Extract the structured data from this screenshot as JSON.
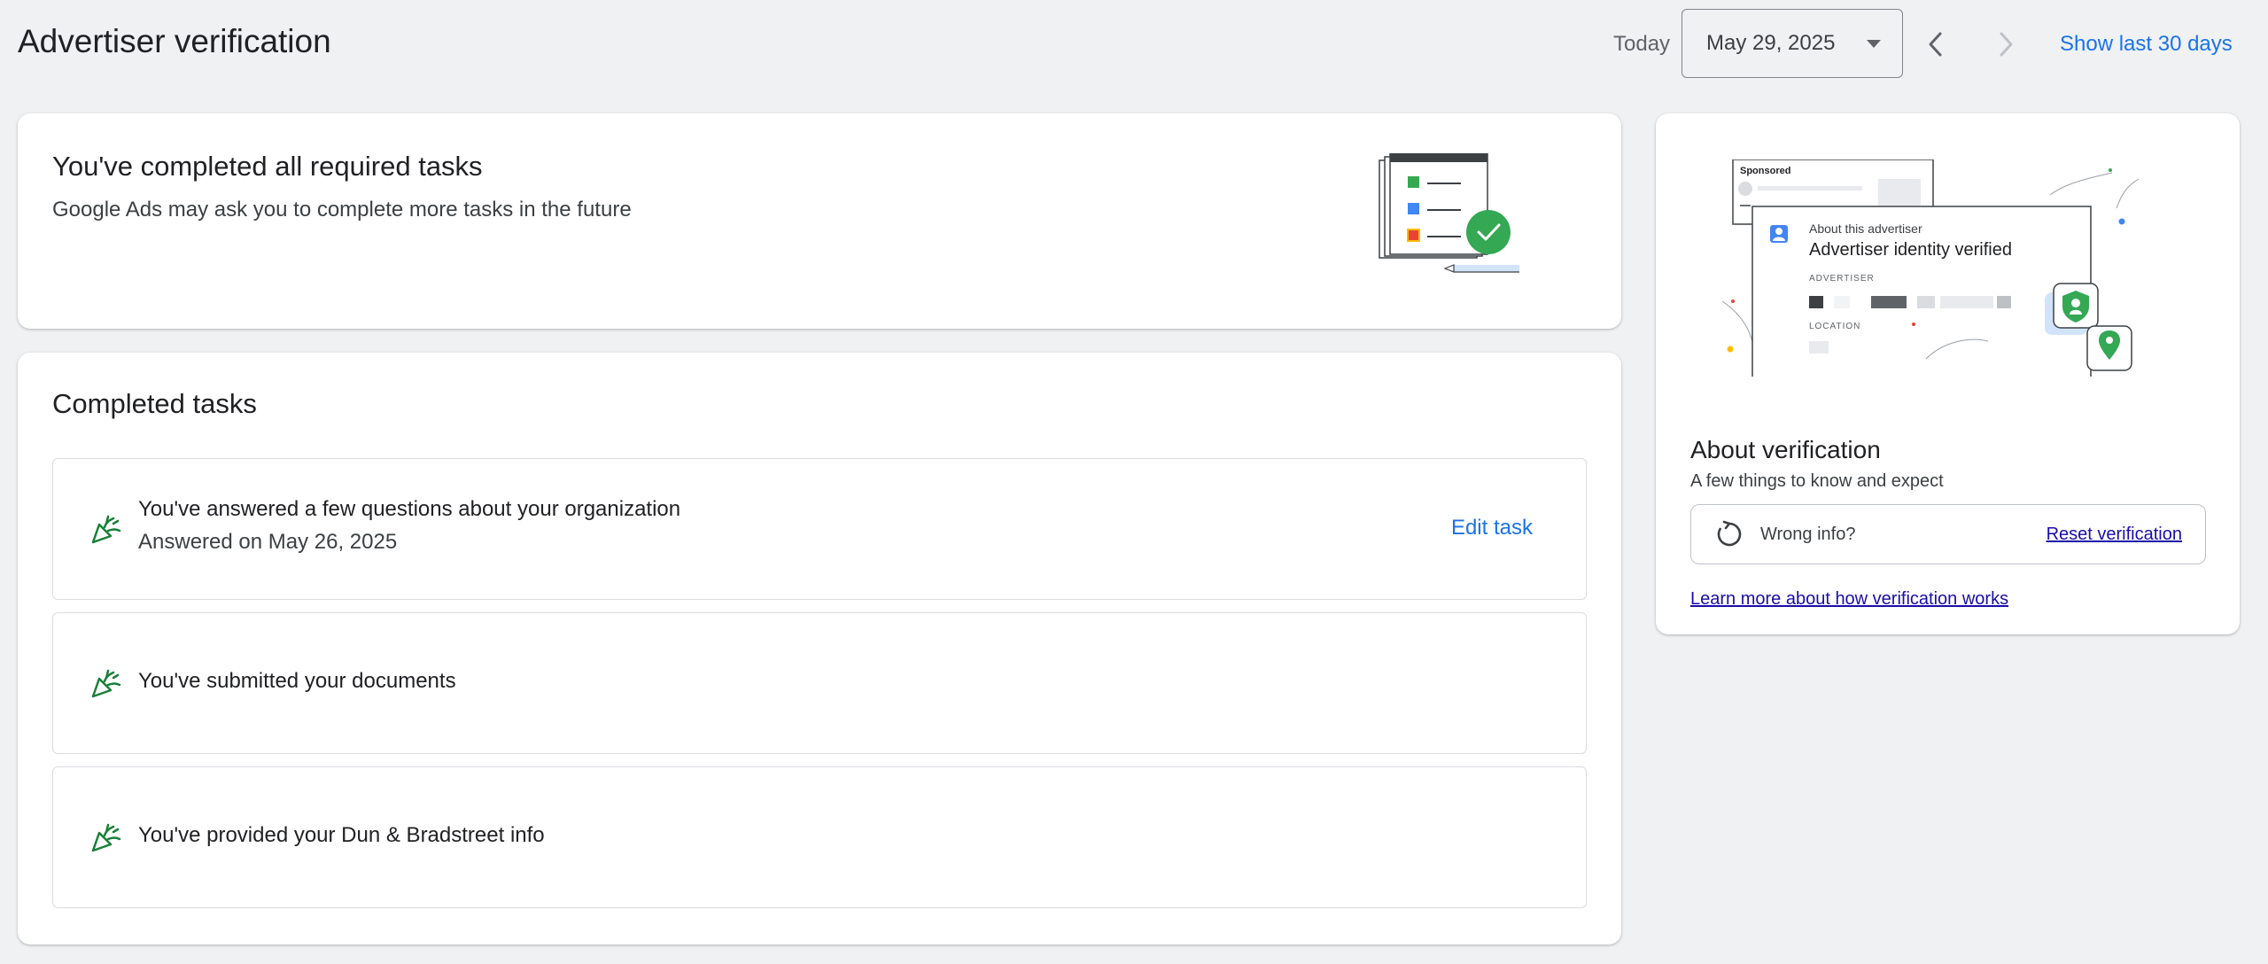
{
  "header": {
    "title": "Advertiser verification",
    "today_label": "Today",
    "date_value": "May 29, 2025",
    "show_last": "Show last 30 days"
  },
  "summary": {
    "title": "You've completed all required tasks",
    "subtitle": "Google Ads may ask you to complete more tasks in the future"
  },
  "tasks": {
    "title": "Completed tasks",
    "items": [
      {
        "title": "You've answered a few questions about your organization",
        "sub": "Answered on May 26, 2025",
        "action": "Edit task"
      },
      {
        "title": "You've submitted your documents"
      },
      {
        "title": "You've provided your Dun & Bradstreet info"
      }
    ]
  },
  "about": {
    "illus": {
      "sponsored": "Sponsored",
      "about_advertiser": "About this advertiser",
      "identity_verified": "Advertiser identity verified",
      "advertiser_label": "ADVERTISER",
      "location_label": "LOCATION"
    },
    "title": "About verification",
    "subtitle": "A few things to know and expect",
    "wrong_info": "Wrong info?",
    "reset_link": "Reset verification",
    "learn_link": "Learn more about how verification works"
  },
  "colors": {
    "accent": "#1a73e8",
    "success": "#34a853",
    "task_icon": "#188038",
    "link_visited": "#1a0dab"
  }
}
